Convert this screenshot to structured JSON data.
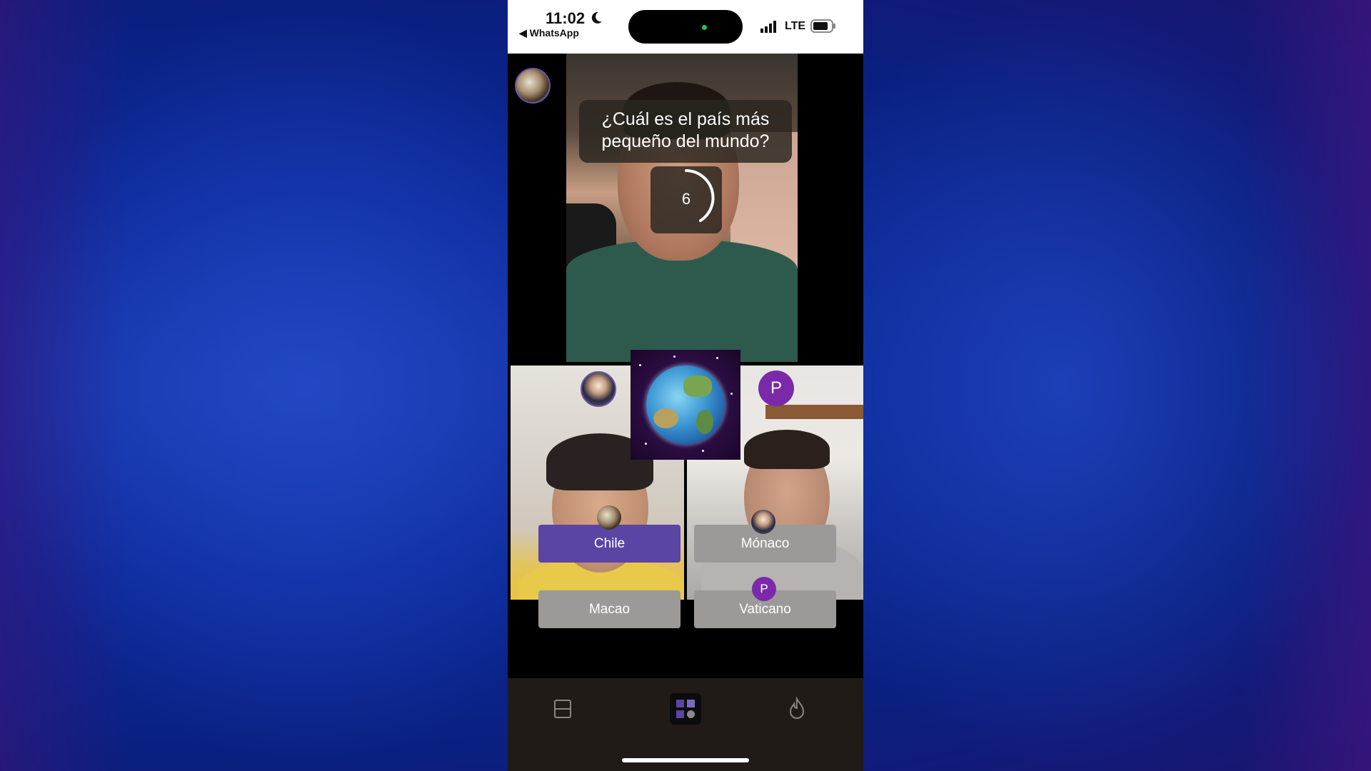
{
  "status_bar": {
    "time": "11:02",
    "back_app": "◀ WhatsApp",
    "network": "LTE"
  },
  "quiz": {
    "question": "¿Cuál es el país más pequeño del mundo?",
    "timer": "6",
    "answers": [
      {
        "label": "Chile",
        "selected": true
      },
      {
        "label": "Mónaco",
        "selected": false
      },
      {
        "label": "Macao",
        "selected": false
      },
      {
        "label": "Vaticano",
        "selected": false
      }
    ]
  },
  "participants": {
    "p_initial": "P"
  },
  "toolbar": {
    "icons": [
      "layout-icon",
      "grid-games-icon",
      "fire-icon"
    ]
  },
  "colors": {
    "accent_selected": "#5a45a5",
    "answer_default": "#9c9a98",
    "avatar_p": "#7a2aa8",
    "background": "#0c2a9a"
  }
}
